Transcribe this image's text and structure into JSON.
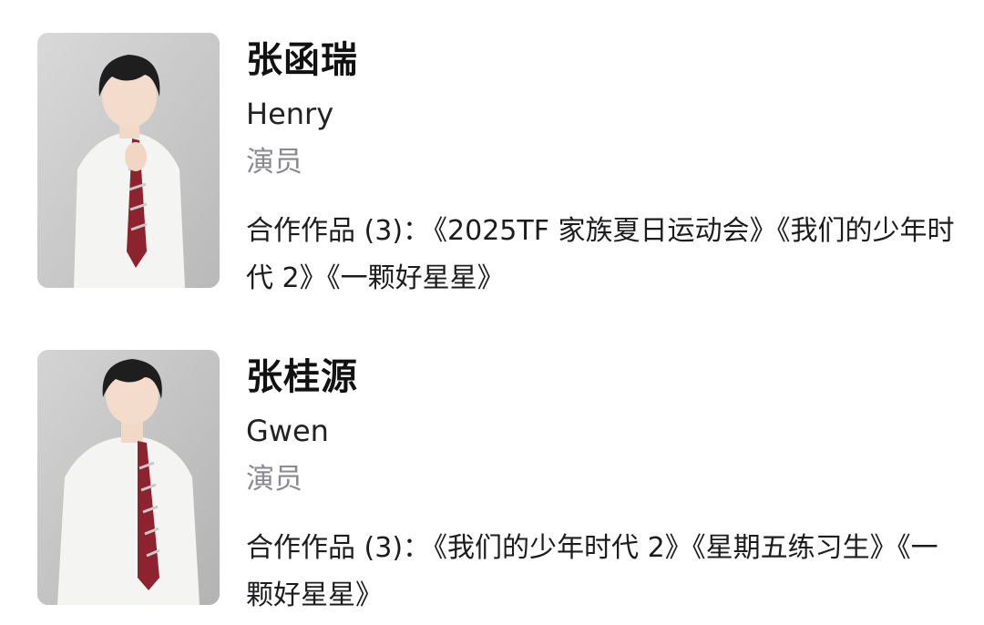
{
  "profiles": [
    {
      "name": "张函瑞",
      "english_name": "Henry",
      "role": "演员",
      "works_label": "合作作品 (3)：",
      "works_text": "《2025TF 家族夏日运动会》《我们的少年时代 2》《一颗好星星》"
    },
    {
      "name": "张桂源",
      "english_name": "Gwen",
      "role": "演员",
      "works_label": "合作作品 (3)：",
      "works_text": "《我们的少年时代 2》《星期五练习生》《一颗好星星》"
    }
  ]
}
